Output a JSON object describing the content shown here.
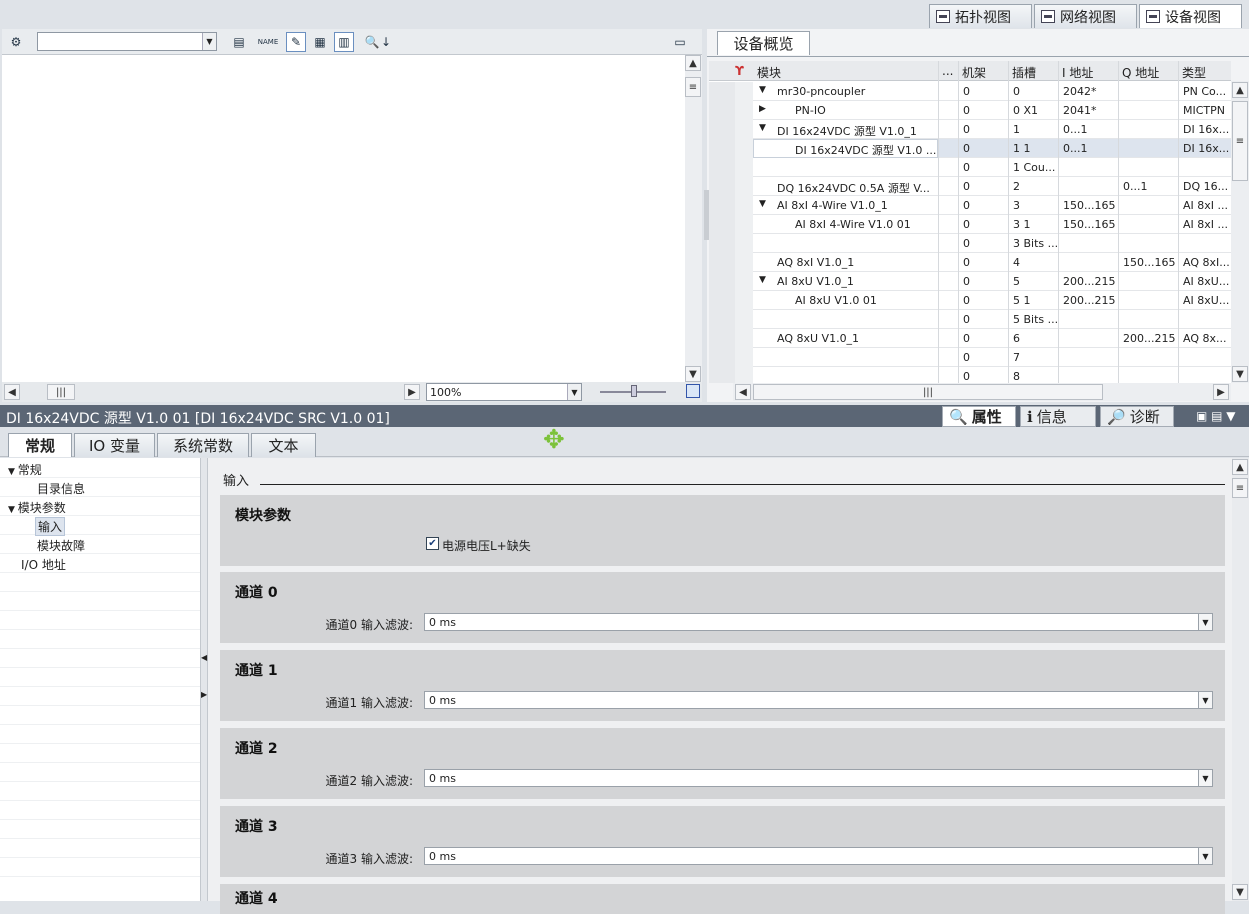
{
  "view_tabs": {
    "topology": "拓扑视图",
    "network": "网络视图",
    "device": "设备视图"
  },
  "graphic_toolbar": {
    "device_select_value": "",
    "zoom": "100%"
  },
  "overview": {
    "tab_label": "设备概览",
    "columns": {
      "module": "模块",
      "dots": "...",
      "rack": "机架",
      "slot": "插槽",
      "i_addr": "I 地址",
      "q_addr": "Q 地址",
      "type": "类型"
    },
    "rows": [
      {
        "expander": "▼",
        "indent": 0,
        "module": "mr30-pncoupler",
        "rack": "0",
        "slot": "0",
        "i_addr": "2042*",
        "q_addr": "",
        "type": "PN Co..."
      },
      {
        "expander": "▶",
        "indent": 1,
        "module": "PN-IO",
        "rack": "0",
        "slot": "0 X1",
        "i_addr": "2041*",
        "q_addr": "",
        "type": "MICTPN"
      },
      {
        "expander": "▼",
        "indent": 0,
        "module": "DI 16x24VDC 源型 V1.0_1",
        "rack": "0",
        "slot": "1",
        "i_addr": "0...1",
        "q_addr": "",
        "type": "DI 16x..."
      },
      {
        "expander": "",
        "indent": 1,
        "module": "DI 16x24VDC 源型 V1.0 ...",
        "rack": "0",
        "slot": "1 1",
        "i_addr": "0...1",
        "q_addr": "",
        "type": "DI 16x...",
        "selected": true
      },
      {
        "expander": "",
        "indent": 0,
        "module": "",
        "rack": "0",
        "slot": "1 Cou...",
        "i_addr": "",
        "q_addr": "",
        "type": ""
      },
      {
        "expander": "",
        "indent": 0,
        "module": "DQ 16x24VDC 0.5A 源型 V...",
        "rack": "0",
        "slot": "2",
        "i_addr": "",
        "q_addr": "0...1",
        "type": "DQ 16..."
      },
      {
        "expander": "▼",
        "indent": 0,
        "module": "AI 8xI 4-Wire V1.0_1",
        "rack": "0",
        "slot": "3",
        "i_addr": "150...165",
        "q_addr": "",
        "type": "AI 8xI ..."
      },
      {
        "expander": "",
        "indent": 1,
        "module": "AI 8xI 4-Wire V1.0 01",
        "rack": "0",
        "slot": "3 1",
        "i_addr": "150...165",
        "q_addr": "",
        "type": "AI 8xI ..."
      },
      {
        "expander": "",
        "indent": 0,
        "module": "",
        "rack": "0",
        "slot": "3 Bits ...",
        "i_addr": "",
        "q_addr": "",
        "type": ""
      },
      {
        "expander": "",
        "indent": 0,
        "module": "AQ 8xI V1.0_1",
        "rack": "0",
        "slot": "4",
        "i_addr": "",
        "q_addr": "150...165",
        "type": "AQ 8xI..."
      },
      {
        "expander": "▼",
        "indent": 0,
        "module": "AI 8xU V1.0_1",
        "rack": "0",
        "slot": "5",
        "i_addr": "200...215",
        "q_addr": "",
        "type": "AI 8xU..."
      },
      {
        "expander": "",
        "indent": 1,
        "module": "AI 8xU V1.0 01",
        "rack": "0",
        "slot": "5 1",
        "i_addr": "200...215",
        "q_addr": "",
        "type": "AI 8xU..."
      },
      {
        "expander": "",
        "indent": 0,
        "module": "",
        "rack": "0",
        "slot": "5 Bits ...",
        "i_addr": "",
        "q_addr": "",
        "type": ""
      },
      {
        "expander": "",
        "indent": 0,
        "module": "AQ 8xU V1.0_1",
        "rack": "0",
        "slot": "6",
        "i_addr": "",
        "q_addr": "200...215",
        "type": "AQ 8x..."
      },
      {
        "expander": "",
        "indent": 0,
        "module": "",
        "rack": "0",
        "slot": "7",
        "i_addr": "",
        "q_addr": "",
        "type": ""
      },
      {
        "expander": "",
        "indent": 0,
        "module": "",
        "rack": "0",
        "slot": "8",
        "i_addr": "",
        "q_addr": "",
        "type": ""
      }
    ]
  },
  "inspector": {
    "title": "DI 16x24VDC 源型 V1.0 01 [DI 16x24VDC SRC V1.0 01]",
    "tabs": {
      "properties": "属性",
      "info": "信息",
      "diagnostics": "诊断"
    },
    "subtabs": [
      "常规",
      "IO 变量",
      "系统常数",
      "文本"
    ],
    "nav": {
      "general": "常规",
      "catalog_info": "目录信息",
      "module_params": "模块参数",
      "input": "输入",
      "module_fault": "模块故障",
      "io_address": "I/O 地址"
    },
    "section_title": "输入",
    "module_params_title": "模块参数",
    "supply_voltage_label": "电源电压L+缺失",
    "supply_voltage_checked": true,
    "channels": [
      {
        "title": "通道 0",
        "label": "通道0 输入滤波:",
        "value": "0 ms"
      },
      {
        "title": "通道 1",
        "label": "通道1 输入滤波:",
        "value": "0 ms"
      },
      {
        "title": "通道 2",
        "label": "通道2 输入滤波:",
        "value": "0 ms"
      },
      {
        "title": "通道 3",
        "label": "通道3 输入滤波:",
        "value": "0 ms"
      },
      {
        "title": "通道 4",
        "label": "",
        "value": ""
      }
    ]
  },
  "colors": {
    "accent": "#5b6675",
    "move_icon": "#7cc23a"
  }
}
